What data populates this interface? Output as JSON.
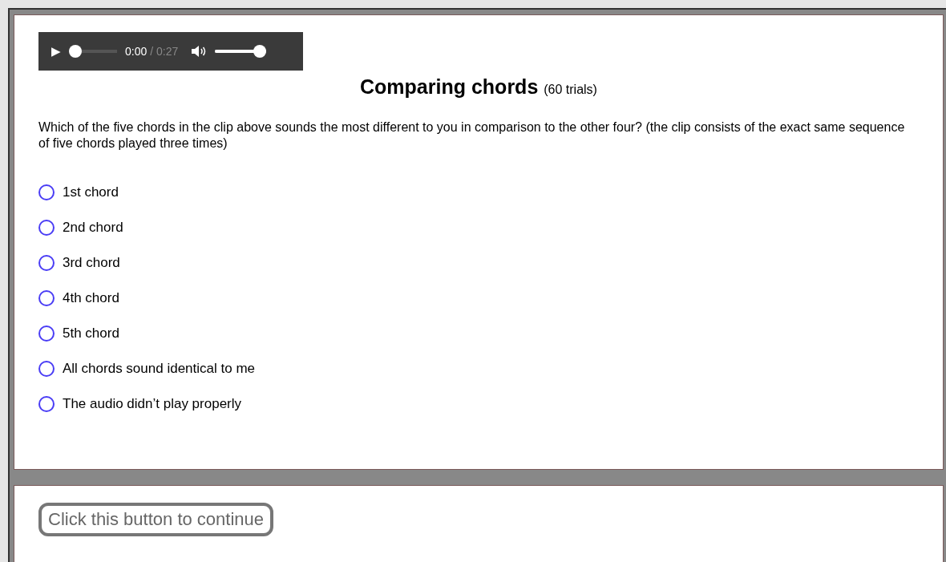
{
  "audio_player": {
    "play_icon": "▶",
    "progress": {
      "level": 0
    },
    "current_time": "0:00",
    "duration": "/ 0:27",
    "volume": {
      "level": 1
    }
  },
  "title": "Comparing chords",
  "trials": "(60 trials)",
  "question": "Which of the five chords in the clip above sounds the most different to you in comparison to the other four? (the clip consists of the exact same sequence of five chords played three times)",
  "options": [
    {
      "label": "1st chord",
      "selected": false
    },
    {
      "label": "2nd chord",
      "selected": false
    },
    {
      "label": "3rd chord",
      "selected": false
    },
    {
      "label": "4th chord",
      "selected": false
    },
    {
      "label": "5th chord",
      "selected": false
    },
    {
      "label": "All chords sound identical to me",
      "selected": false
    },
    {
      "label": "The audio didn’t play properly",
      "selected": false
    }
  ],
  "continue_button": "Click this button to continue"
}
